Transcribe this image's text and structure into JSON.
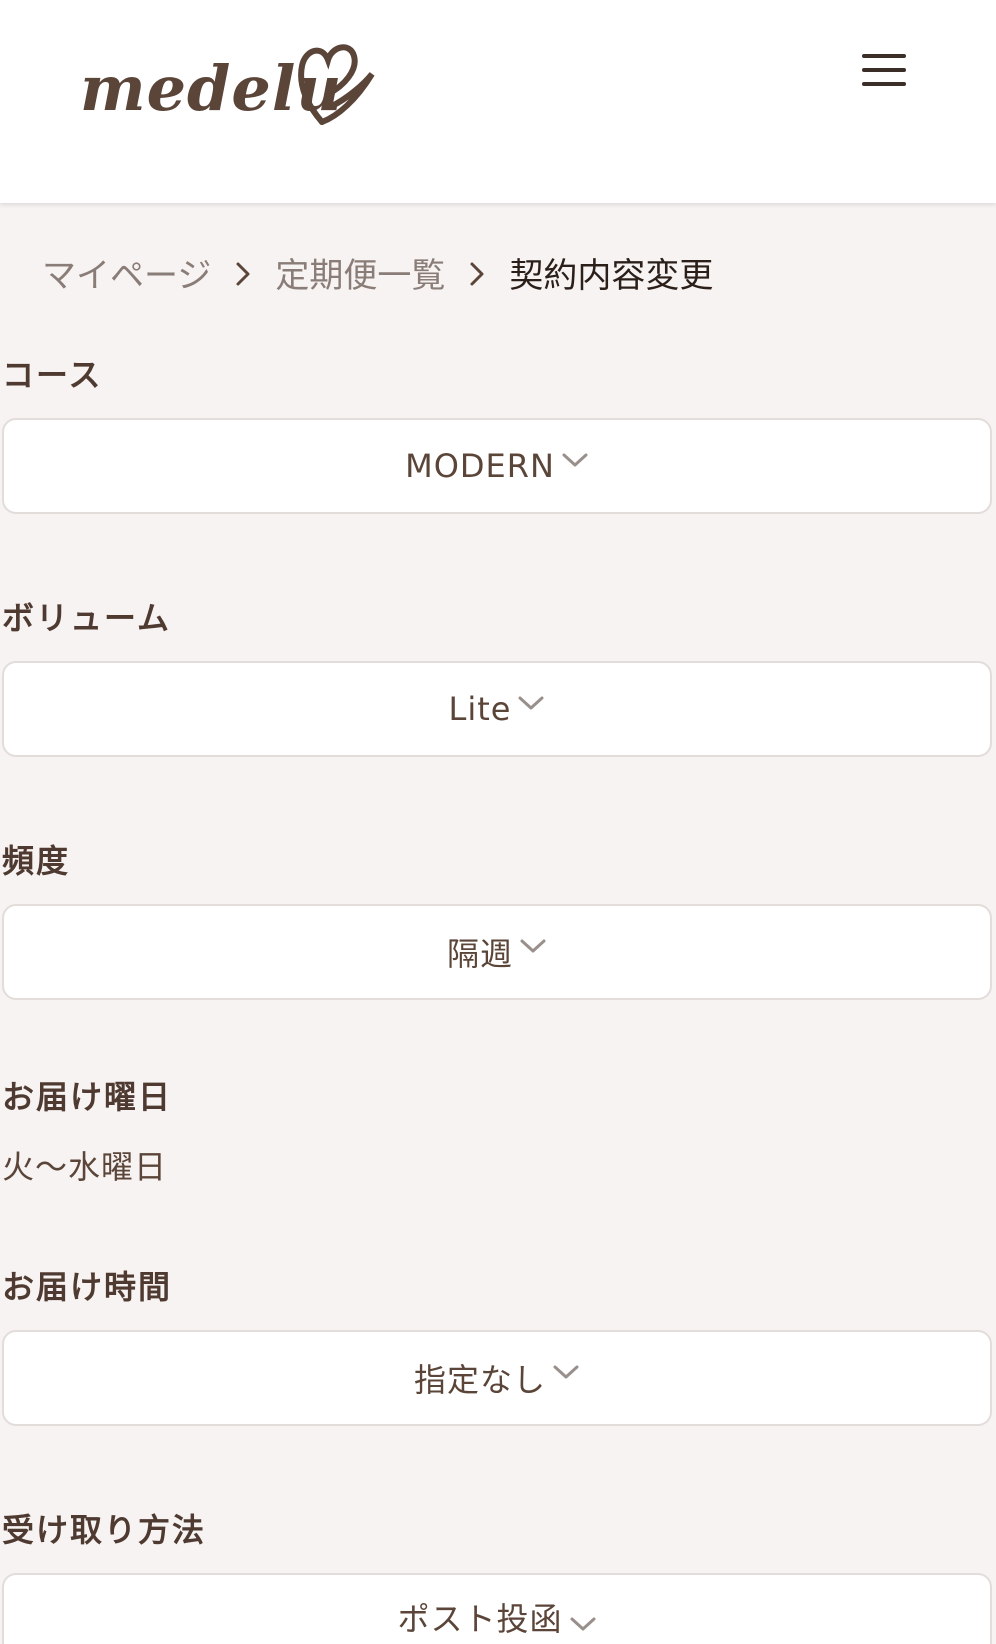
{
  "header": {
    "logo_text": "medelu",
    "menu_icon": "hamburger-menu-icon"
  },
  "breadcrumb": {
    "items": [
      "マイページ",
      "定期便一覧"
    ],
    "current": "契約内容変更",
    "separator_icon": "chevron-right-icon"
  },
  "form": {
    "course": {
      "label": "コース",
      "value": "MODERN"
    },
    "volume": {
      "label": "ボリューム",
      "value": "Lite"
    },
    "frequency": {
      "label": "頻度",
      "value": "隔週"
    },
    "delivery_day": {
      "label": "お届け曜日",
      "value": "火〜水曜日"
    },
    "delivery_time": {
      "label": "お届け時間",
      "value": "指定なし"
    },
    "receive_method": {
      "label": "受け取り方法",
      "value": "ポスト投函"
    }
  },
  "colors": {
    "background": "#f7f3f2",
    "brand_brown": "#5b4539",
    "border": "#e2dcda"
  }
}
